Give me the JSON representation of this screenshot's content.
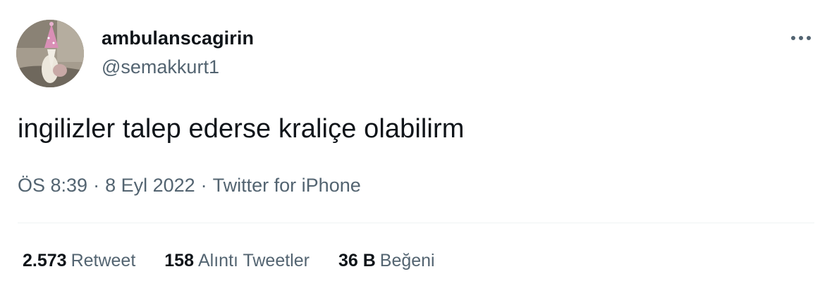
{
  "user": {
    "display_name": "ambulanscagirin",
    "handle": "@semakkurt1",
    "avatar_icon": "dog-with-party-hat-avatar"
  },
  "menu": {
    "icon": "more-dots-icon"
  },
  "tweet": {
    "text": "ingilizler talep ederse kraliçe olabilirm",
    "time": "ÖS 8:39",
    "date": "8 Eyl 2022",
    "source": "Twitter for iPhone",
    "separator": "·"
  },
  "stats": [
    {
      "count": "2.573",
      "label": "Retweet"
    },
    {
      "count": "158",
      "label": "Alıntı Tweetler"
    },
    {
      "count": "36 B",
      "label": "Beğeni"
    }
  ],
  "colors": {
    "text_primary": "#0f1419",
    "text_secondary": "#536471",
    "divider": "#eff3f4"
  }
}
